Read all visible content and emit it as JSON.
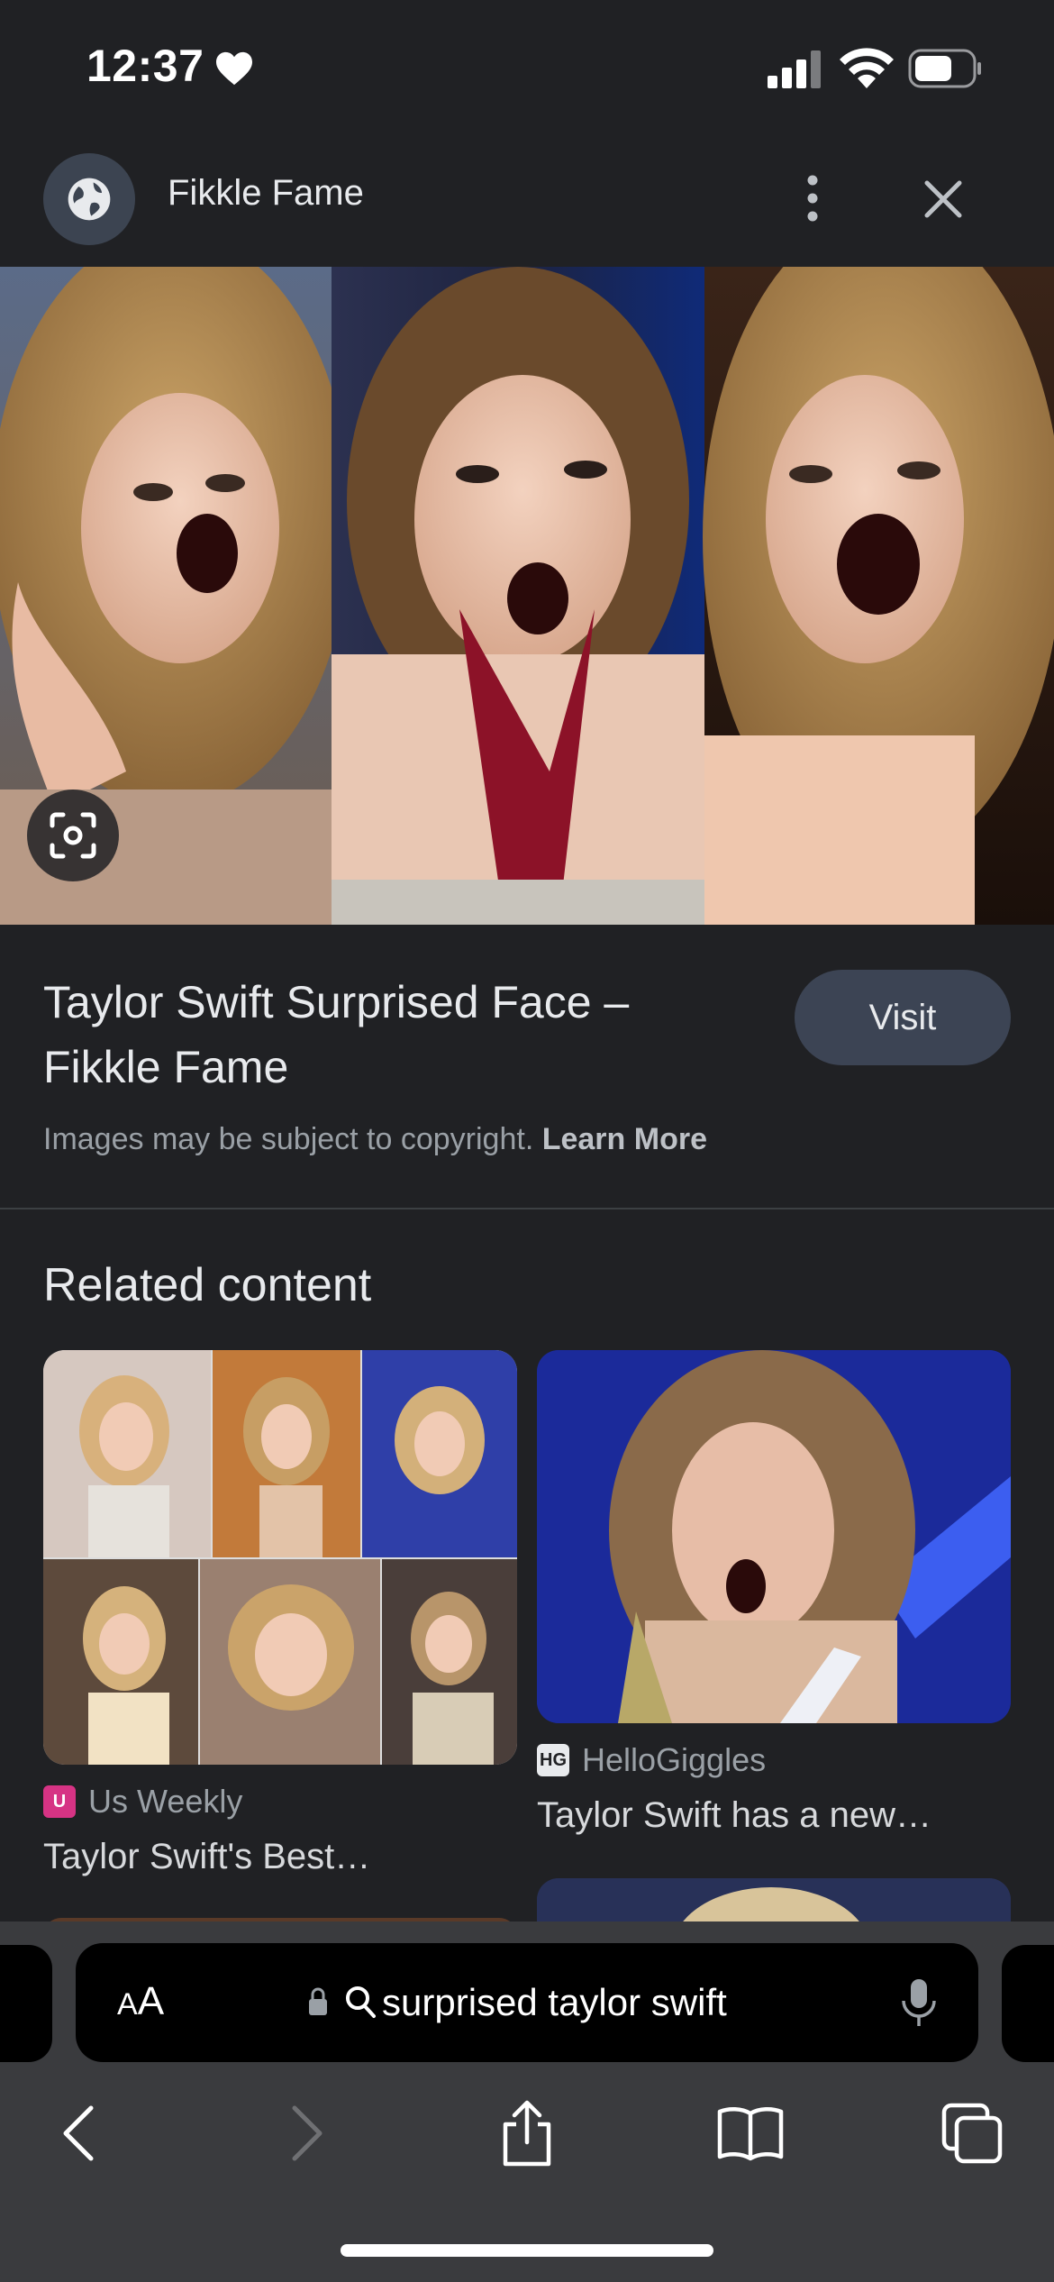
{
  "status_bar": {
    "time": "12:37"
  },
  "header": {
    "site_name": "Fikkle Fame"
  },
  "result": {
    "title": "Taylor Swift Surprised Face – Fikkle Fame",
    "visit_label": "Visit",
    "copyright_text": "Images may be subject to copyright.",
    "learn_more": "Learn More"
  },
  "related": {
    "heading": "Related content",
    "items": [
      {
        "source": "Us Weekly",
        "favicon": "US",
        "title": "Taylor Swift's Best…",
        "favicon_color": "#d63384"
      },
      {
        "source": "HelloGiggles",
        "favicon": "HG",
        "title": "Taylor Swift has a new…",
        "favicon_color": "#e8eaed"
      }
    ]
  },
  "browser": {
    "aa_label_small": "A",
    "aa_label_large": "A",
    "address": "surprised taylor swift"
  },
  "icons": {
    "heart": "heart-icon",
    "signal": "signal-icon",
    "wifi": "wifi-icon",
    "battery": "battery-icon",
    "globe": "globe-icon",
    "more": "more-vertical-icon",
    "close": "close-icon",
    "lens": "lens-icon",
    "lock": "lock-icon",
    "search": "search-icon",
    "mic": "microphone-icon",
    "back": "back-arrow-icon",
    "forward": "forward-arrow-icon",
    "share": "share-icon",
    "bookmarks": "bookmarks-icon",
    "tabs": "tabs-icon"
  },
  "colors": {
    "background": "#202124",
    "visit_button": "#3c4454",
    "browser_bar": "#3a3b3e"
  }
}
